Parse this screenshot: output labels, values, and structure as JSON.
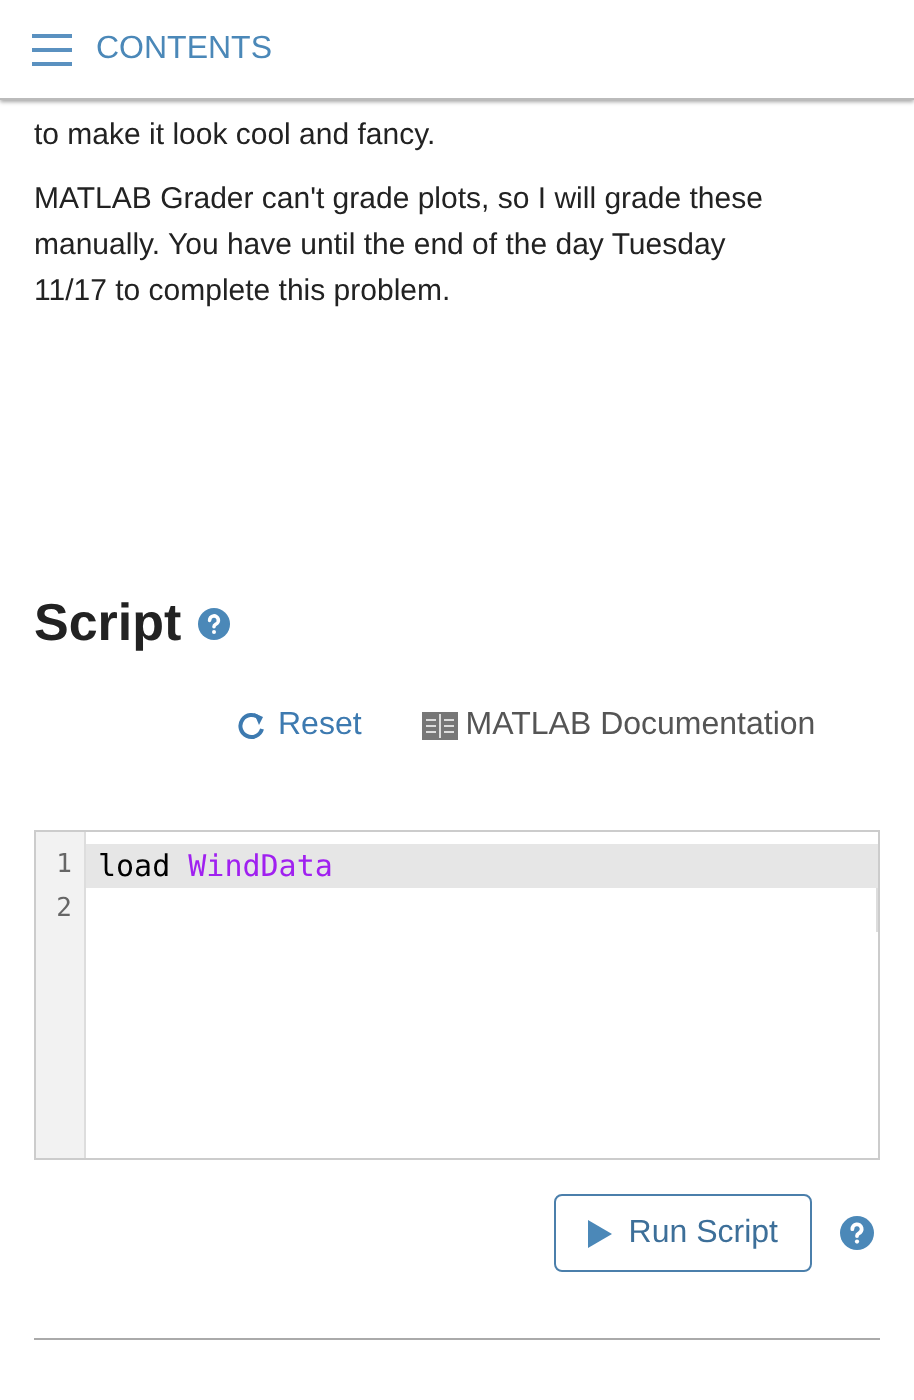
{
  "header": {
    "title": "CONTENTS"
  },
  "paragraphs": [
    "to make it look cool and fancy.",
    "MATLAB Grader can't grade plots, so I will grade these manually. You have until the end of the day Tuesday 11/17 to complete this problem."
  ],
  "script": {
    "heading": "Script",
    "reset": "Reset",
    "documentation": "MATLAB Documentation",
    "lines": [
      {
        "number": "1",
        "active": true,
        "tokens": [
          {
            "text": "load",
            "kind": "command"
          },
          {
            "text": "WindData",
            "kind": "argument"
          }
        ]
      },
      {
        "number": "2",
        "active": false
      }
    ],
    "run_button": "Run Script"
  }
}
